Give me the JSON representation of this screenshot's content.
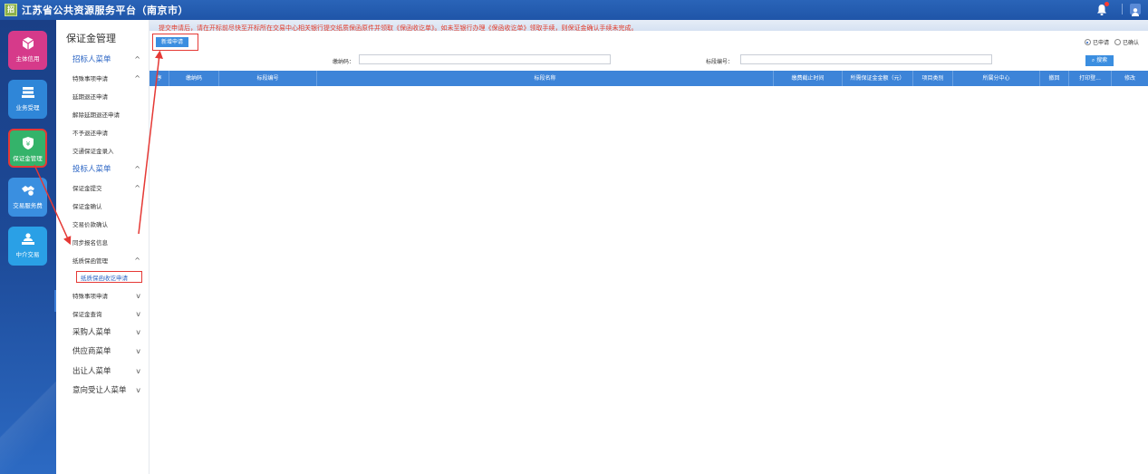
{
  "header": {
    "logo_text": "招",
    "title": "江苏省公共资源服务平台（南京市）",
    "bell_icon": "bell-icon",
    "user_icon": "user-icon"
  },
  "leftnav": {
    "items": [
      {
        "label": "主体信用",
        "icon": "cube-icon",
        "color": "#d63a8a"
      },
      {
        "label": "业务受理",
        "icon": "stack-icon",
        "color": "#2f86d8"
      },
      {
        "label": "保证金管理",
        "icon": "shield-yen-icon",
        "color": "#34b36a"
      },
      {
        "label": "交易服务费",
        "icon": "handshake-icon",
        "color": "#3a8fe0"
      },
      {
        "label": "中介交易",
        "icon": "person-desk-icon",
        "color": "#2aa0e6"
      }
    ]
  },
  "submenu": {
    "title": "保证金管理",
    "items": [
      {
        "label": "招标人菜单",
        "level": 1,
        "style": "blue",
        "chev": "^"
      },
      {
        "label": "特殊事项申请",
        "level": 2,
        "chev": "^"
      },
      {
        "label": "延期退还申请",
        "level": 3
      },
      {
        "label": "解除延期退还申请",
        "level": 3
      },
      {
        "label": "不予退还申请",
        "level": 3
      },
      {
        "label": "交通保证金录入",
        "level": 2
      },
      {
        "label": "投标人菜单",
        "level": 1,
        "style": "blue",
        "chev": "^"
      },
      {
        "label": "保证金提交",
        "level": 2,
        "chev": "^"
      },
      {
        "label": "保证金确认",
        "level": 3
      },
      {
        "label": "交易价款确认",
        "level": 3
      },
      {
        "label": "同步报名信息",
        "level": 3
      },
      {
        "label": "纸质保函管理",
        "level": 3,
        "chev": "^"
      },
      {
        "label": "纸质保函收讫申请",
        "level": 4,
        "active": true
      },
      {
        "label": "特殊事项申请",
        "level": 2,
        "chev": "v"
      },
      {
        "label": "保证金查询",
        "level": 2,
        "chev": "v"
      },
      {
        "label": "采购人菜单",
        "level": 1,
        "style": "dark",
        "chev": "v"
      },
      {
        "label": "供应商菜单",
        "level": 1,
        "style": "dark",
        "chev": "v"
      },
      {
        "label": "出让人菜单",
        "level": 1,
        "style": "dark",
        "chev": "v"
      },
      {
        "label": "意向受让人菜单",
        "level": 1,
        "style": "dark",
        "chev": "v"
      }
    ]
  },
  "main": {
    "notice": "提交申请后，请在开标前尽快至开标所在交易中心相关银行提交纸质保函原件并领取《保函收讫单》。如未至银行办理《保函收讫单》领取手续，则保证金确认手续未完成。",
    "new_button": "新增申请",
    "radio_applied": "已申请",
    "radio_confirmed": "已确认",
    "filter_code_label": "缴纳码：",
    "filter_code_value": "",
    "filter_section_label": "标段编号：",
    "filter_section_value": "",
    "search_button": "搜索",
    "table_headers": [
      "序",
      "缴纳码",
      "标段编号",
      "标段名称",
      "缴费截止时间",
      "所需保证金金额（元）",
      "项目类别",
      "所属分中心",
      "撤回",
      "打印登...",
      "修改"
    ]
  }
}
